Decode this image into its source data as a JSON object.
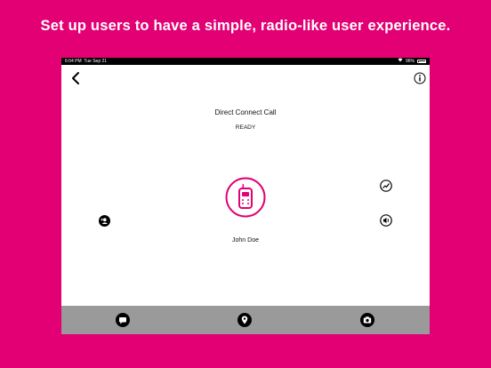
{
  "headline": "Set up users to have a simple, radio-like user experience.",
  "statusbar": {
    "time": "6:04 PM",
    "date": "Tue Sep 21",
    "battery": "96%"
  },
  "call": {
    "title": "Direct Connect Call",
    "status": "READY",
    "contact_name": "John Doe"
  },
  "colors": {
    "brand": "#e20074",
    "tabbar": "#9a9a9a"
  },
  "icons": {
    "back": "chevron-left-icon",
    "info": "info-icon",
    "ptt": "walkie-talkie-icon",
    "add_user": "add-user-icon",
    "activity": "activity-icon",
    "volume": "volume-icon",
    "chat": "chat-icon",
    "location": "location-pin-icon",
    "camera": "camera-icon"
  }
}
